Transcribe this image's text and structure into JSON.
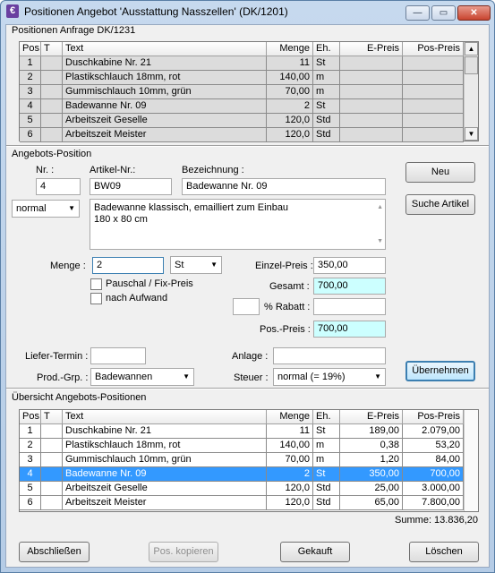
{
  "window": {
    "title": "Positionen Angebot 'Ausstattung Nasszellen' (DK/1201)",
    "app_icon_letter": "€",
    "minimize_icon": "minimize-icon",
    "maximize_icon": "maximize-icon",
    "close_icon": "close-icon",
    "min_glyph": "—",
    "max_glyph": "▭",
    "close_glyph": "✕"
  },
  "anfrage": {
    "section_label": "Positionen Anfrage DK/1231",
    "columns": [
      "Pos.",
      "T",
      "Text",
      "Menge",
      "Eh.",
      "E-Preis",
      "Pos-Preis"
    ],
    "rows": [
      {
        "pos": "1",
        "t": "",
        "text": "Duschkabine Nr. 21",
        "menge": "11",
        "eh": "St",
        "epreis": "",
        "pospreis": ""
      },
      {
        "pos": "2",
        "t": "",
        "text": "Plastikschlauch 18mm, rot",
        "menge": "140,00",
        "eh": "m",
        "epreis": "",
        "pospreis": ""
      },
      {
        "pos": "3",
        "t": "",
        "text": "Gummischlauch 10mm, grün",
        "menge": "70,00",
        "eh": "m",
        "epreis": "",
        "pospreis": ""
      },
      {
        "pos": "4",
        "t": "",
        "text": "Badewanne Nr. 09",
        "menge": "2",
        "eh": "St",
        "epreis": "",
        "pospreis": ""
      },
      {
        "pos": "5",
        "t": "",
        "text": "Arbeitszeit Geselle",
        "menge": "120,0",
        "eh": "Std",
        "epreis": "",
        "pospreis": ""
      },
      {
        "pos": "6",
        "t": "",
        "text": "Arbeitszeit Meister",
        "menge": "120,0",
        "eh": "Std",
        "epreis": "",
        "pospreis": ""
      }
    ]
  },
  "position": {
    "section_label": "Angebots-Position",
    "nr_label": "Nr. :",
    "nr_value": "4",
    "artikel_label": "Artikel-Nr.:",
    "artikel_value": "BW09",
    "bezeichnung_label": "Bezeichnung :",
    "bezeichnung_value": "Badewanne Nr. 09",
    "text_type": "normal",
    "text_line1": "Badewanne klassisch, emailliert zum Einbau",
    "text_line2": "180 x 80 cm",
    "neu_button": "Neu",
    "suche_button": "Suche Artikel",
    "menge_label": "Menge :",
    "menge_value": "2",
    "einheit_value": "St",
    "pauschal_label": "Pauschal / Fix-Preis",
    "aufwand_label": "nach Aufwand",
    "einzelpreis_label": "Einzel-Preis :",
    "einzelpreis_value": "350,00",
    "gesamt_label": "Gesamt :",
    "gesamt_value": "700,00",
    "rabatt_label": "% Rabatt :",
    "rabatt_pct": "",
    "rabatt_value": "",
    "pospreis_label": "Pos.-Preis :",
    "pospreis_value": "700,00",
    "liefer_label": "Liefer-Termin :",
    "liefer_value": "",
    "anlage_label": "Anlage :",
    "anlage_value": "",
    "prodgrp_label": "Prod.-Grp. :",
    "prodgrp_value": "Badewannen",
    "steuer_label": "Steuer :",
    "steuer_value": "normal (= 19%)",
    "uebernehmen_button": "Übernehmen"
  },
  "uebersicht": {
    "section_label": "Übersicht Angebots-Positionen",
    "columns": [
      "Pos.",
      "T",
      "Text",
      "Menge",
      "Eh.",
      "E-Preis",
      "Pos-Preis"
    ],
    "rows": [
      {
        "pos": "1",
        "t": "",
        "text": "Duschkabine Nr. 21",
        "menge": "11",
        "eh": "St",
        "epreis": "189,00",
        "pospreis": "2.079,00"
      },
      {
        "pos": "2",
        "t": "",
        "text": "Plastikschlauch 18mm, rot",
        "menge": "140,00",
        "eh": "m",
        "epreis": "0,38",
        "pospreis": "53,20"
      },
      {
        "pos": "3",
        "t": "",
        "text": "Gummischlauch 10mm, grün",
        "menge": "70,00",
        "eh": "m",
        "epreis": "1,20",
        "pospreis": "84,00"
      },
      {
        "pos": "4",
        "t": "",
        "text": "Badewanne Nr. 09",
        "menge": "2",
        "eh": "St",
        "epreis": "350,00",
        "pospreis": "700,00"
      },
      {
        "pos": "5",
        "t": "",
        "text": "Arbeitszeit Geselle",
        "menge": "120,0",
        "eh": "Std",
        "epreis": "25,00",
        "pospreis": "3.000,00"
      },
      {
        "pos": "6",
        "t": "",
        "text": "Arbeitszeit Meister",
        "menge": "120,0",
        "eh": "Std",
        "epreis": "65,00",
        "pospreis": "7.800,00"
      }
    ],
    "selected_row": 4,
    "summe": "Summe: 13.836,20"
  },
  "footer": {
    "abschliessen": "Abschließen",
    "kopieren": "Pos. kopieren",
    "gekauft": "Gekauft",
    "loeschen": "Löschen"
  },
  "colors": {
    "selection": "#3399ff",
    "readonly_cyan": "#ccffff",
    "title_gradient": "#c6d9ee"
  }
}
